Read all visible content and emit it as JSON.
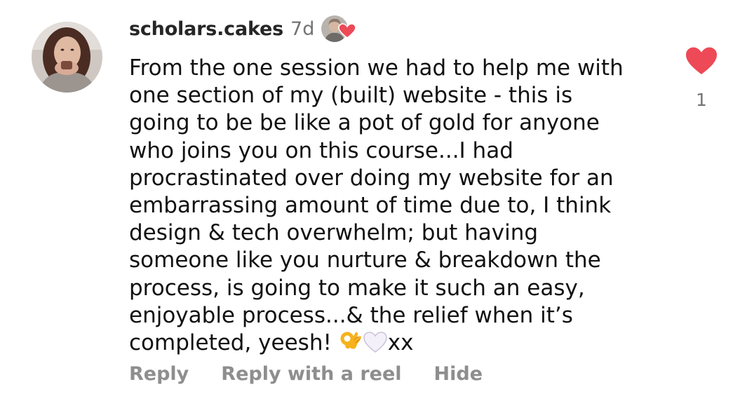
{
  "comment": {
    "username": "scholars.cakes",
    "time_ago": "7d",
    "text_lines": [
      "From the one session we had to help me with",
      "one section of my (built) website - this is",
      "going to be be like a pot of gold for anyone",
      "who joins you on this course...I had",
      "procrastinated over doing my website for an",
      "embarrassing amount of time due to, I think",
      "design & tech overwhelm; but having",
      "someone like you nurture & breakdown the",
      "process, is going to make it such an easy,",
      "enjoyable process...& the relief when it’s",
      "completed, yeesh!"
    ],
    "text_end": "xx",
    "emojis": [
      "ok-hand-emoji",
      "white-heart-emoji"
    ],
    "liked_by_author": true,
    "like": {
      "count": "1",
      "liked": true,
      "icon": "heart-icon",
      "color": "#ed4956"
    }
  },
  "actions": {
    "reply": "Reply",
    "reply_with_reel": "Reply with a reel",
    "hide": "Hide"
  }
}
